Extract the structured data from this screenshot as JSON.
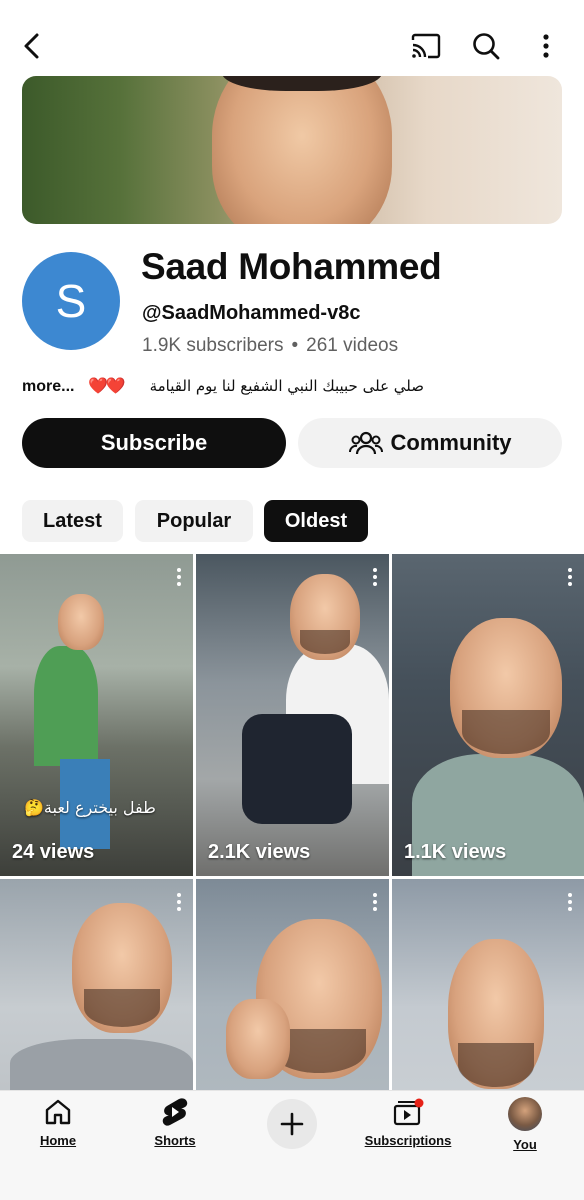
{
  "header": {
    "back_icon": "chevron-left-icon",
    "cast_icon": "cast-icon",
    "search_icon": "search-icon",
    "more_icon": "more-vertical-icon"
  },
  "channel": {
    "avatar_letter": "S",
    "avatar_color": "#3d88d1",
    "name": "Saad Mohammed",
    "handle": "@SaadMohammed-v8c",
    "subscribers": "1.9K subscribers",
    "separator": "•",
    "videos": "261 videos",
    "description": "صلي على حبيبك النبي الشفيع لنا يوم القيامة",
    "description_hearts": "❤️❤️",
    "more_label": "more..."
  },
  "actions": {
    "subscribe_label": "Subscribe",
    "community_label": "Community"
  },
  "filters": {
    "chips": [
      "Latest",
      "Popular",
      "Oldest"
    ],
    "selected": "Oldest"
  },
  "videos": [
    {
      "views": "24 views",
      "caption": "طفل بيخترع لعبة🤔"
    },
    {
      "views": "2.1K views",
      "caption": ""
    },
    {
      "views": "1.1K views",
      "caption": ""
    },
    {
      "views": "",
      "caption": ""
    },
    {
      "views": "",
      "caption": ""
    },
    {
      "views": "",
      "caption": ""
    }
  ],
  "bottom_nav": {
    "home": "Home",
    "shorts": "Shorts",
    "create_icon": "plus-icon",
    "subscriptions": "Subscriptions",
    "you": "You"
  },
  "colors": {
    "subscribe_bg": "#0f0f0f",
    "chip_bg": "#f2f2f2",
    "notification_dot": "#e62117"
  }
}
